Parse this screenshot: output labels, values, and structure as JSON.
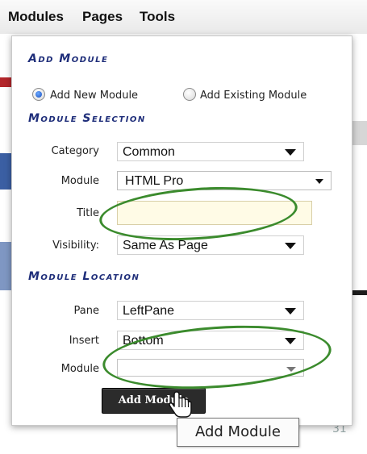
{
  "menu": {
    "items": [
      "Modules",
      "Pages",
      "Tools"
    ]
  },
  "panel": {
    "add_module_heading": "Add Module",
    "radios": [
      {
        "label": "Add New Module",
        "checked": true
      },
      {
        "label": "Add Existing Module",
        "checked": false
      }
    ],
    "module_selection_heading": "Module Selection",
    "fields": {
      "category": {
        "label": "Category",
        "value": "Common"
      },
      "module": {
        "label": "Module",
        "value": "HTML Pro"
      },
      "title": {
        "label": "Title",
        "value": ""
      },
      "visibility": {
        "label": "Visibility:",
        "value": "Same As Page"
      }
    },
    "module_location_heading": "Module Location",
    "location": {
      "pane": {
        "label": "Pane",
        "value": "LeftPane"
      },
      "insert": {
        "label": "Insert",
        "value": "Bottom"
      },
      "module": {
        "label": "Module",
        "value": ""
      }
    },
    "add_button_label": "Add Module"
  },
  "tooltip": "Add Module",
  "background_page_number": "31",
  "colors": {
    "heading": "#1f2e7a",
    "annotation": "#3b8b2d",
    "title_input_bg": "#fffbe6"
  }
}
